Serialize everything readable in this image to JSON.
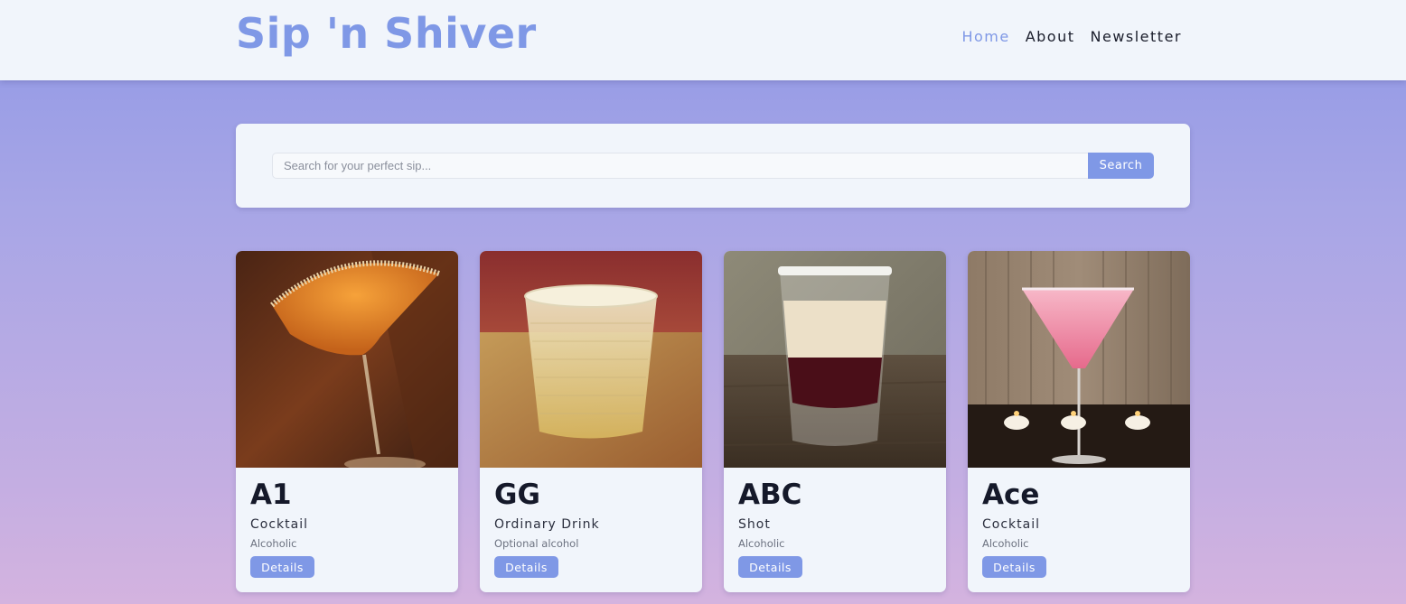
{
  "header": {
    "logo": "Sip 'n Shiver",
    "nav": [
      {
        "label": "Home",
        "active": true
      },
      {
        "label": "About",
        "active": false
      },
      {
        "label": "Newsletter",
        "active": false
      }
    ]
  },
  "search": {
    "placeholder": "Search for your perfect sip...",
    "value": "",
    "button_label": "Search"
  },
  "drinks": [
    {
      "name": "A1",
      "category": "Cocktail",
      "alcoholic": "Alcoholic",
      "details_label": "Details"
    },
    {
      "name": "GG",
      "category": "Ordinary Drink",
      "alcoholic": "Optional alcohol",
      "details_label": "Details"
    },
    {
      "name": "ABC",
      "category": "Shot",
      "alcoholic": "Alcoholic",
      "details_label": "Details"
    },
    {
      "name": "Ace",
      "category": "Cocktail",
      "alcoholic": "Alcoholic",
      "details_label": "Details"
    }
  ],
  "colors": {
    "accent": "#7f98e6",
    "panel": "#f1f5fb",
    "text": "#15192a"
  }
}
